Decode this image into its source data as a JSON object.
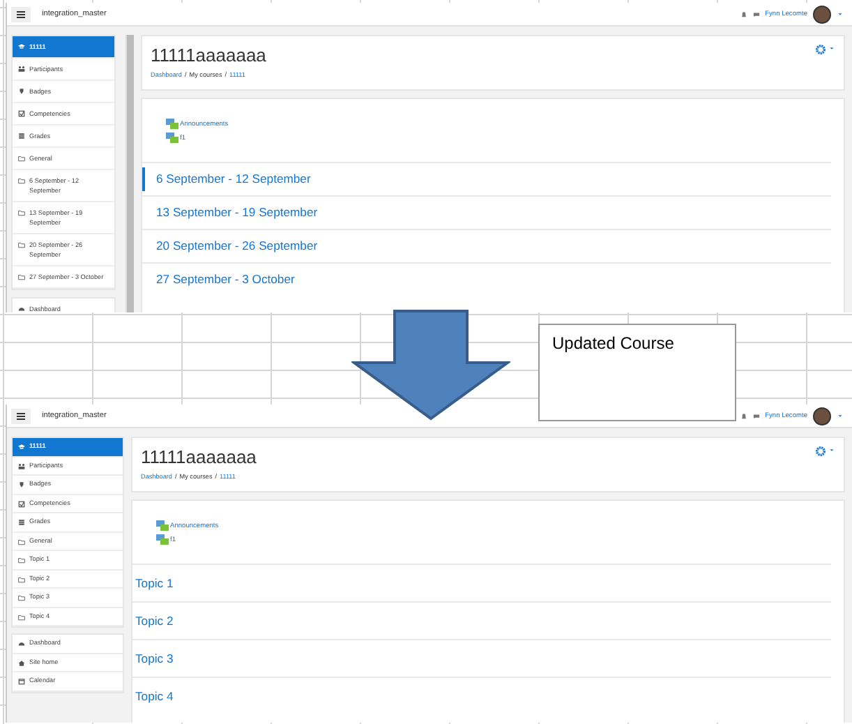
{
  "screens": [
    {
      "navbar": {
        "site_name": "integration_master",
        "user_name": "Fynn Lecomte"
      },
      "sidebar_scrollable": true,
      "breadcrumb_separator": "/",
      "course_nav": [
        {
          "label": "11111",
          "kind": "cap",
          "selected": true
        },
        {
          "label": "Participants",
          "kind": "users",
          "selected": false
        },
        {
          "label": "Badges",
          "kind": "shield",
          "selected": false
        },
        {
          "label": "Competencies",
          "kind": "check",
          "selected": false
        },
        {
          "label": "Grades",
          "kind": "table",
          "selected": false
        },
        {
          "label": "General",
          "kind": "folder",
          "selected": false
        },
        {
          "label": "6 September - 12 September",
          "kind": "folder",
          "selected": false
        },
        {
          "label": "13 September - 19 September",
          "kind": "folder",
          "selected": false
        },
        {
          "label": "20 September - 26 September",
          "kind": "folder",
          "selected": false
        },
        {
          "label": "27 September - 3 October",
          "kind": "folder",
          "selected": false
        }
      ],
      "site_nav": [
        {
          "label": "Dashboard",
          "kind": "dashboard",
          "selected": false
        }
      ],
      "course_title": "11111aaaaaaa",
      "breadcrumbs": [
        {
          "label": "Dashboard",
          "link": true
        },
        {
          "label": "My courses",
          "link": false
        },
        {
          "label": "11111",
          "link": true
        }
      ],
      "activities": [
        {
          "label": "Announcements"
        },
        {
          "label": "f1"
        }
      ],
      "sections": [
        {
          "label": "6 September - 12 September",
          "current": true
        },
        {
          "label": "13 September - 19 September",
          "current": false
        },
        {
          "label": "20 September - 26 September",
          "current": false
        },
        {
          "label": "27 September - 3 October",
          "current": false
        }
      ]
    },
    {
      "navbar": {
        "site_name": "integration_master",
        "user_name": "Fynn Lecomte"
      },
      "sidebar_scrollable": false,
      "breadcrumb_separator": "/",
      "course_nav": [
        {
          "label": "11111",
          "kind": "cap",
          "selected": true
        },
        {
          "label": "Participants",
          "kind": "users",
          "selected": false
        },
        {
          "label": "Badges",
          "kind": "shield",
          "selected": false
        },
        {
          "label": "Competencies",
          "kind": "check",
          "selected": false
        },
        {
          "label": "Grades",
          "kind": "table",
          "selected": false
        },
        {
          "label": "General",
          "kind": "folder",
          "selected": false
        },
        {
          "label": "Topic 1",
          "kind": "folder",
          "selected": false
        },
        {
          "label": "Topic 2",
          "kind": "folder",
          "selected": false
        },
        {
          "label": "Topic 3",
          "kind": "folder",
          "selected": false
        },
        {
          "label": "Topic 4",
          "kind": "folder",
          "selected": false
        }
      ],
      "site_nav": [
        {
          "label": "Dashboard",
          "kind": "dashboard",
          "selected": false
        },
        {
          "label": "Site home",
          "kind": "home",
          "selected": false
        },
        {
          "label": "Calendar",
          "kind": "calendar",
          "selected": false
        }
      ],
      "course_title": "11111aaaaaaa",
      "breadcrumbs": [
        {
          "label": "Dashboard",
          "link": true
        },
        {
          "label": "My courses",
          "link": false
        },
        {
          "label": "11111",
          "link": true
        }
      ],
      "activities": [
        {
          "label": "Announcements"
        },
        {
          "label": "f1"
        }
      ],
      "sections": [
        {
          "label": "Topic 1",
          "current": false
        },
        {
          "label": "Topic 2",
          "current": false
        },
        {
          "label": "Topic 3",
          "current": false
        },
        {
          "label": "Topic 4",
          "current": false
        }
      ]
    }
  ],
  "callout": {
    "text": "Updated Course"
  }
}
